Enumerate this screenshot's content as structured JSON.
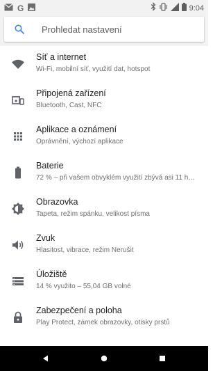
{
  "status_bar": {
    "left_icons": [
      "gmail-icon",
      "google-icon",
      "photos-icon"
    ],
    "google_letter": "G",
    "right_icons": [
      "bluetooth-icon",
      "vibrate-icon",
      "wifi-signal-icon",
      "battery-icon"
    ],
    "time": "9:04"
  },
  "search": {
    "icon": "search-icon",
    "placeholder": "Prohledat nastavení"
  },
  "settings": [
    {
      "icon": "wifi-icon",
      "title": "Síť a internet",
      "subtitle": "Wi-Fi, mobilní síť, využití dat, hotspot"
    },
    {
      "icon": "devices-icon",
      "title": "Připojená zařízení",
      "subtitle": "Bluetooth, Cast, NFC"
    },
    {
      "icon": "apps-icon",
      "title": "Aplikace a oznámení",
      "subtitle": "Oprávnění, výchozí aplikace"
    },
    {
      "icon": "battery-icon",
      "title": "Baterie",
      "subtitle": "72 % – při vašem obvyklém využití zbývá asi 11 h…"
    },
    {
      "icon": "brightness-icon",
      "title": "Obrazovka",
      "subtitle": "Tapeta, režim spánku, velikost písma"
    },
    {
      "icon": "volume-icon",
      "title": "Zvuk",
      "subtitle": "Hlasitost, vibrace, režim Nerušit"
    },
    {
      "icon": "storage-icon",
      "title": "Úložiště",
      "subtitle": "14 % využito – 55,04 GB volné"
    },
    {
      "icon": "lock-icon",
      "title": "Zabezpečení a poloha",
      "subtitle": "Play Protect, zámek obrazovky, otisky prstů"
    }
  ],
  "nav_bar": {
    "buttons": [
      "back-icon",
      "home-icon",
      "recents-icon"
    ]
  },
  "colors": {
    "icon": "#5f6368",
    "search_accent": "#4285f4",
    "background": "#f2f2f2"
  }
}
